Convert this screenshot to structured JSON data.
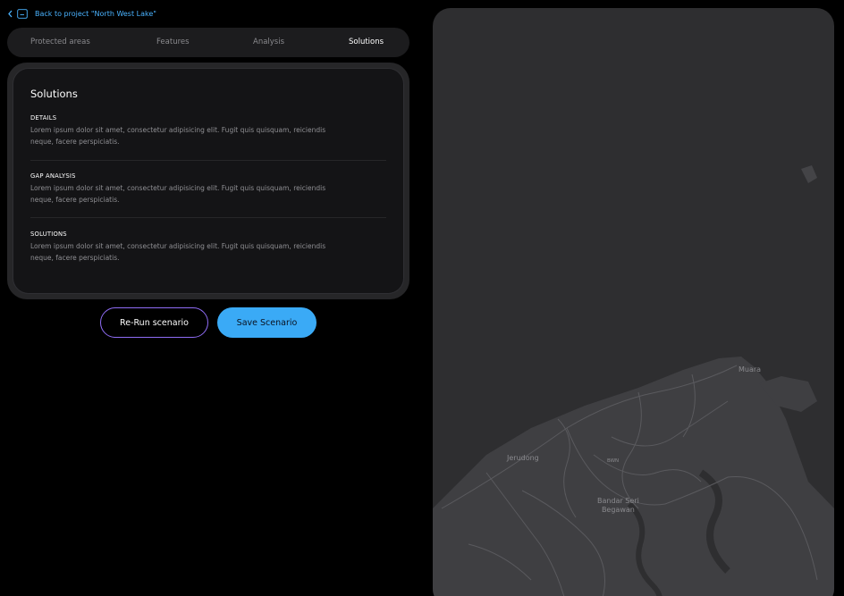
{
  "header": {
    "back_label": "Back to project \"North West Lake\""
  },
  "tabs": [
    {
      "label": "Protected areas",
      "active": false
    },
    {
      "label": "Features",
      "active": false
    },
    {
      "label": "Analysis",
      "active": false
    },
    {
      "label": "Solutions",
      "active": true
    }
  ],
  "card": {
    "title": "Solutions",
    "sections": [
      {
        "label": "DETAILS",
        "body": "Lorem ipsum dolor sit amet, consectetur adipisicing elit. Fugit quis quisquam, reiciendis neque, facere perspiciatis."
      },
      {
        "label": "GAP ANALYSIS",
        "body": "Lorem ipsum dolor sit amet, consectetur adipisicing elit. Fugit quis quisquam, reiciendis neque, facere perspiciatis."
      },
      {
        "label": "SOLUTIONS",
        "body": "Lorem ipsum dolor sit amet, consectetur adipisicing elit. Fugit quis quisquam, reiciendis neque, facere perspiciatis."
      }
    ]
  },
  "actions": {
    "rerun_label": "Re-Run scenario",
    "save_label": "Save Scenario"
  },
  "map": {
    "labels": {
      "muara": "Muara",
      "jerudong": "Jerudong",
      "bwn": "BWN",
      "city_line1": "Bandar Seri",
      "city_line2": "Begawan"
    }
  },
  "colors": {
    "accent": "#3aaaf6",
    "outline": "#8f6cf5",
    "link": "#4ab3ff"
  }
}
